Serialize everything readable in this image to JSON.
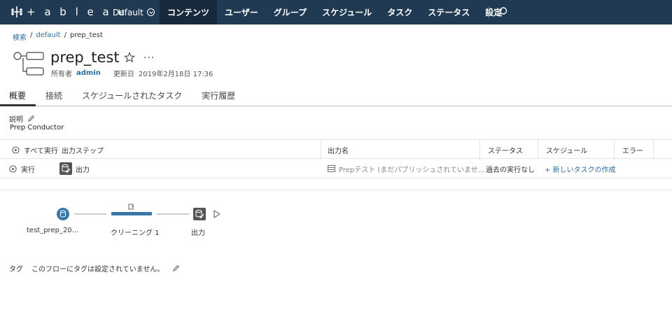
{
  "app": {
    "logo_text": "+ a b l e a u",
    "site": "Default",
    "nav": [
      "コンテンツ",
      "ユーザー",
      "グループ",
      "スケジュール",
      "タスク",
      "ステータス",
      "設定"
    ],
    "active_nav": "コンテンツ"
  },
  "breadcrumb": {
    "search": "検索",
    "project": "default",
    "current": "prep_test",
    "sep": "/"
  },
  "header": {
    "title": "prep_test",
    "more": "···",
    "owner_label": "所有者",
    "owner": "admin",
    "updated_label": "更新日",
    "updated": "2019年2月18日 17:36"
  },
  "tabs": [
    "概要",
    "接続",
    "スケジュールされたタスク",
    "実行履歴"
  ],
  "description": {
    "label": "説明",
    "value": "Prep Conductor"
  },
  "table": {
    "header": {
      "run_all": "すべて実行",
      "output_steps": "出力ステップ",
      "output_name": "出力名",
      "status": "ステータス",
      "schedule": "スケジュール",
      "error": "エラー"
    },
    "rows": [
      {
        "run": "実行",
        "step": "出力",
        "output_name": "Prepテスト (まだパブリッシュされていませ...",
        "status": "過去の実行なし",
        "schedule": "+ 新しいタスクの作成",
        "error": ""
      }
    ]
  },
  "flow": {
    "nodes": [
      {
        "label": "test_prep_20...",
        "kind": "input"
      },
      {
        "label": "クリーニング 1",
        "kind": "clean"
      },
      {
        "label": "出力",
        "kind": "output"
      }
    ]
  },
  "tags": {
    "label": "タグ",
    "value": "このフローにタグは設定されていません。"
  },
  "colors": {
    "nav_bg": "#1f3a52",
    "nav_active": "#162a3c",
    "link": "#2c6e9e",
    "flow_blue": "#3a76a8",
    "output_dark": "#555555"
  }
}
